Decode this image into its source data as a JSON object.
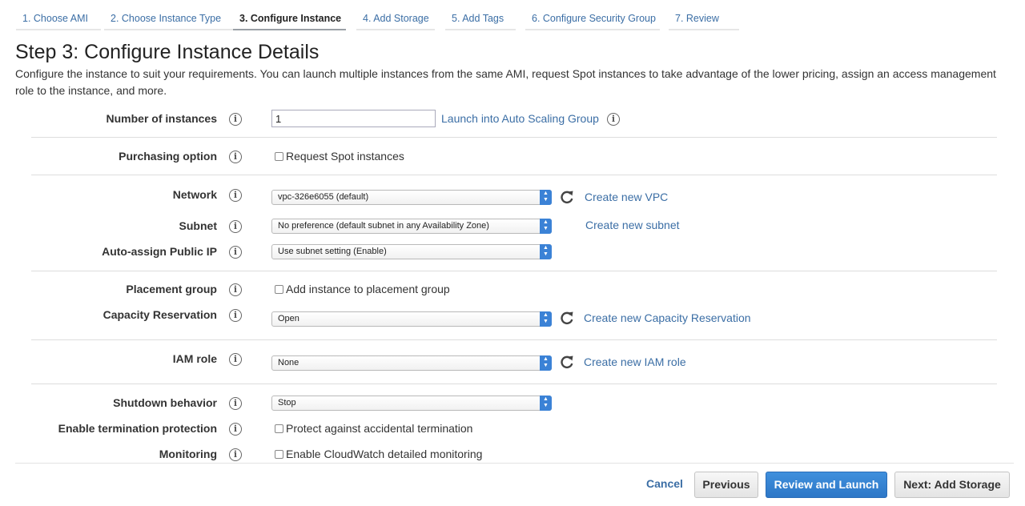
{
  "tabs": [
    {
      "label": "1. Choose AMI",
      "active": false
    },
    {
      "label": "2. Choose Instance Type",
      "active": false
    },
    {
      "label": "3. Configure Instance",
      "active": true
    },
    {
      "label": "4. Add Storage",
      "active": false
    },
    {
      "label": "5. Add Tags",
      "active": false
    },
    {
      "label": "6. Configure Security Group",
      "active": false
    },
    {
      "label": "7. Review",
      "active": false
    }
  ],
  "page": {
    "title": "Step 3: Configure Instance Details",
    "description": "Configure the instance to suit your requirements. You can launch multiple instances from the same AMI, request Spot instances to take advantage of the lower pricing, assign an access management role to the instance, and more."
  },
  "info_icon": "i",
  "form": {
    "number_of_instances": {
      "label": "Number of instances",
      "value": "1",
      "link": "Launch into Auto Scaling Group"
    },
    "purchasing_option": {
      "label": "Purchasing option",
      "checkbox_label": "Request Spot instances"
    },
    "network": {
      "label": "Network",
      "value": "vpc-326e6055 (default)",
      "link": "Create new VPC"
    },
    "subnet": {
      "label": "Subnet",
      "value": "No preference (default subnet in any Availability Zone)",
      "link": "Create new subnet"
    },
    "auto_assign_ip": {
      "label": "Auto-assign Public IP",
      "value": "Use subnet setting (Enable)"
    },
    "placement_group": {
      "label": "Placement group",
      "checkbox_label": "Add instance to placement group"
    },
    "capacity_reservation": {
      "label": "Capacity Reservation",
      "value": "Open",
      "link": "Create new Capacity Reservation"
    },
    "iam_role": {
      "label": "IAM role",
      "value": "None",
      "link": "Create new IAM role"
    },
    "shutdown_behavior": {
      "label": "Shutdown behavior",
      "value": "Stop"
    },
    "termination_protection": {
      "label": "Enable termination protection",
      "checkbox_label": "Protect against accidental termination"
    },
    "monitoring": {
      "label": "Monitoring",
      "checkbox_label": "Enable CloudWatch detailed monitoring"
    }
  },
  "footer": {
    "cancel": "Cancel",
    "previous": "Previous",
    "review_launch": "Review and Launch",
    "next": "Next: Add Storage"
  },
  "colors": {
    "link": "#3b6ea5",
    "primary_button": "#2d77c7",
    "select_arrow": "#3b82d6"
  },
  "icons": [
    "info-icon",
    "refresh-icon",
    "select-arrows-icon"
  ]
}
